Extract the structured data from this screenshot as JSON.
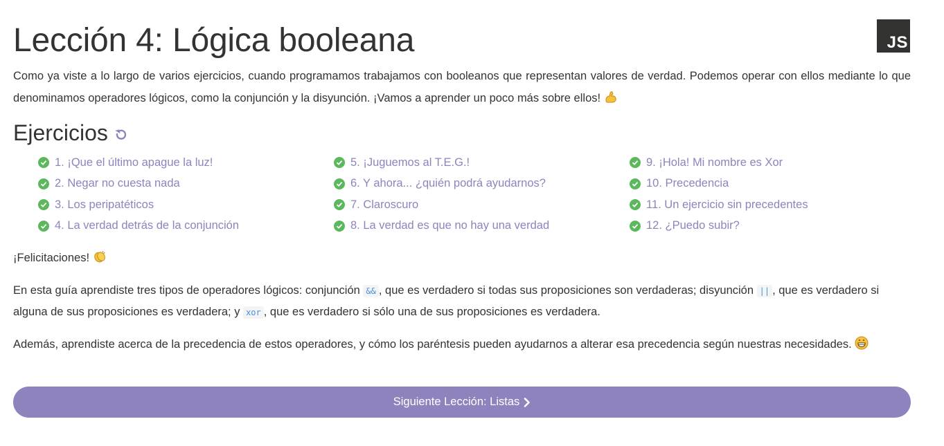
{
  "lesson": {
    "title": "Lección 4: Lógica booleana",
    "logo_text": "JS"
  },
  "intro": {
    "text": "Como ya viste a lo largo de varios ejercicios, cuando programamos trabajamos con booleanos que representan valores de verdad. Podemos operar con ellos mediante lo que denominamos operadores lógicos, como la conjunción y la disyunción. ¡Vamos a aprender un poco más sobre ellos!",
    "emoji": "flexed-biceps"
  },
  "exercises_section": {
    "title": "Ejercicios",
    "restart_icon": "restart-icon",
    "items": [
      {
        "label": "1. ¡Que el último apague la luz!",
        "status": "completed"
      },
      {
        "label": "2. Negar no cuesta nada",
        "status": "completed"
      },
      {
        "label": "3. Los peripatéticos",
        "status": "completed"
      },
      {
        "label": "4. La verdad detrás de la conjunción",
        "status": "completed"
      },
      {
        "label": "5. ¡Juguemos al T.E.G.!",
        "status": "completed"
      },
      {
        "label": "6. Y ahora... ¿quién podrá ayudarnos?",
        "status": "completed"
      },
      {
        "label": "7. Claroscuro",
        "status": "completed"
      },
      {
        "label": "8. La verdad es que no hay una verdad",
        "status": "completed"
      },
      {
        "label": "9. ¡Hola! Mi nombre es Xor",
        "status": "completed"
      },
      {
        "label": "10. Precedencia",
        "status": "completed"
      },
      {
        "label": "11. Un ejercicio sin precedentes",
        "status": "completed"
      },
      {
        "label": "12. ¿Puedo subir?",
        "status": "completed"
      }
    ]
  },
  "summary": {
    "congrats": "¡Felicitaciones!",
    "ops_part1": "En esta guía aprendiste tres tipos de operadores lógicos: conjunción",
    "op_and": "&&",
    "ops_part2": ", que es verdadero si todas sus proposiciones son verdaderas; disyunción",
    "op_or": "||",
    "ops_part3": ", que es verdadero si alguna de sus proposiciones es verdadera; y",
    "op_xor": "xor",
    "ops_part4": ", que es verdadero si sólo una de sus proposiciones es verdadera.",
    "precedence": "Además, aprendiste acerca de la precedencia de estos operadores, y cómo los paréntesis pueden ayudarnos a alterar esa precedencia según nuestras necesidades."
  },
  "next_button": {
    "label": "Siguiente Lección: Listas"
  },
  "colors": {
    "accent": "#8f83bd",
    "check": "#5cb85c",
    "text": "#333333",
    "code": "#4a90d9"
  }
}
